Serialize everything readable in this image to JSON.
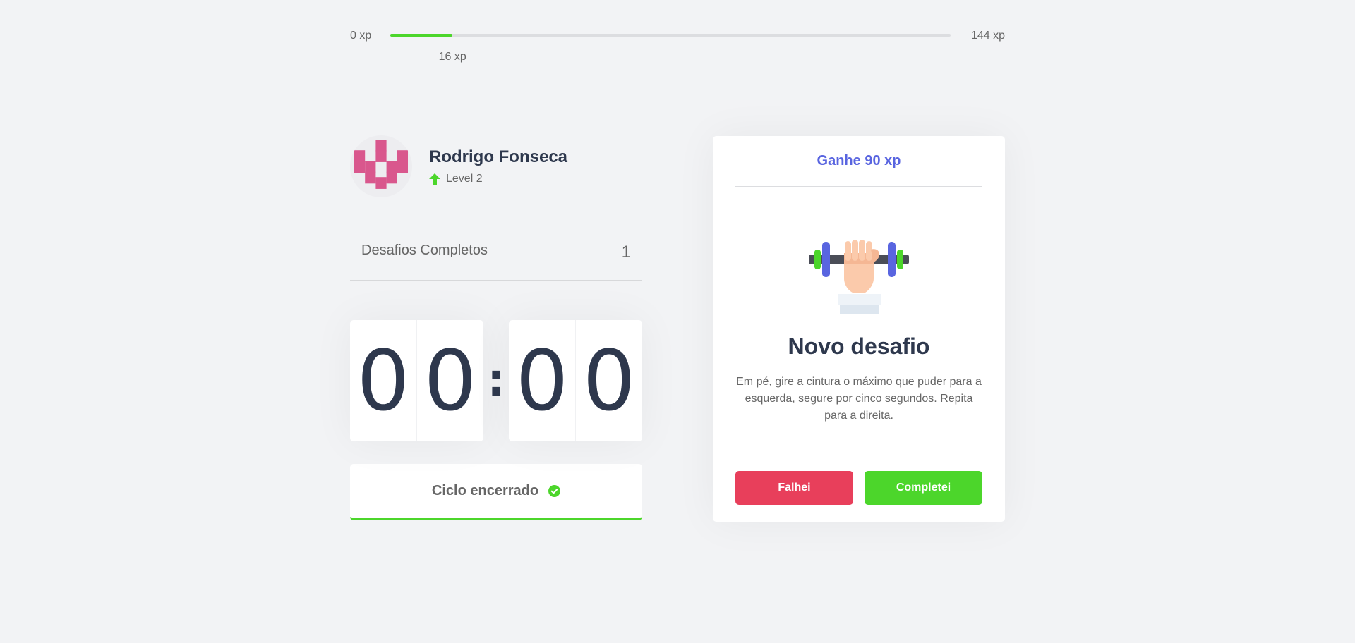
{
  "xp": {
    "min_label": "0 xp",
    "max_label": "144 xp",
    "current_label": "16 xp",
    "current": 16,
    "max": 144,
    "progress_color": "#4cd62b"
  },
  "profile": {
    "name": "Rodrigo Fonseca",
    "level_label": "Level 2",
    "avatar_icon": "pixel-avatar-icon",
    "level_icon": "level-up-arrow-icon"
  },
  "completed": {
    "label": "Desafios Completos",
    "count": "1"
  },
  "countdown": {
    "minute_left": "0",
    "minute_right": "0",
    "separator": ":",
    "second_left": "0",
    "second_right": "0"
  },
  "cycle_button": {
    "label": "Ciclo encerrado",
    "icon": "check-circle-icon"
  },
  "challenge": {
    "header": "Ganhe 90 xp",
    "icon": "dumbbell-icon",
    "title": "Novo desafio",
    "description": "Em pé, gire a cintura o máximo que puder para a esquerda, segure por cinco segundos. Repita para a direita.",
    "fail_label": "Falhei",
    "success_label": "Completei"
  },
  "colors": {
    "accent": "#5965e0",
    "success": "#4cd62b",
    "danger": "#e83f5b",
    "title": "#2e384d",
    "background": "#f2f3f5"
  }
}
